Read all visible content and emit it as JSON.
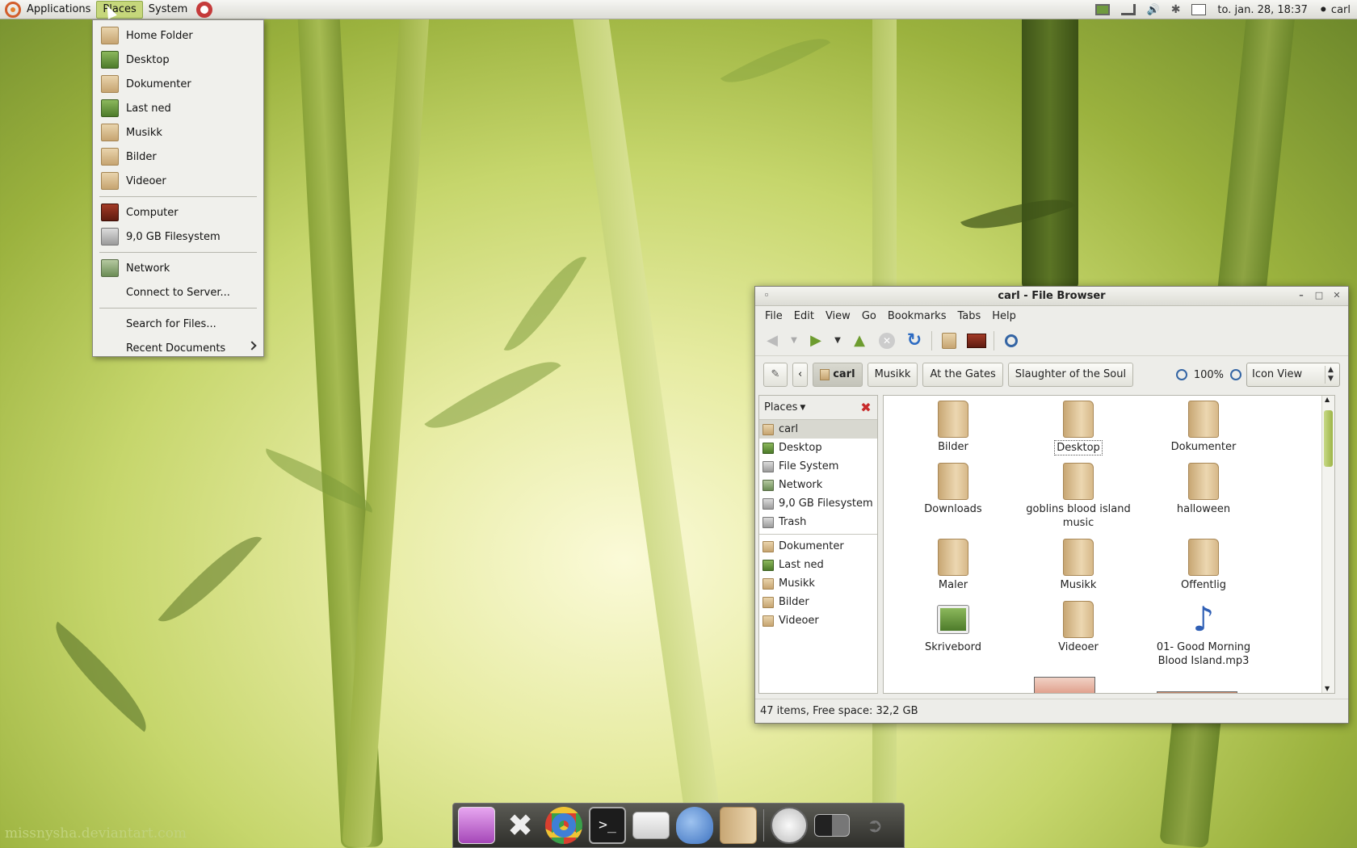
{
  "panel": {
    "applications": "Applications",
    "places": "Places",
    "system": "System",
    "clock": "to. jan. 28, 18:37",
    "user": "carl"
  },
  "places_menu": {
    "items": [
      {
        "label": "Home Folder",
        "icon": "home-folder-icon"
      },
      {
        "label": "Desktop",
        "icon": "desktop-icon"
      },
      {
        "label": "Dokumenter",
        "icon": "documents-folder-icon"
      },
      {
        "label": "Last ned",
        "icon": "downloads-icon"
      },
      {
        "label": "Musikk",
        "icon": "music-folder-icon"
      },
      {
        "label": "Bilder",
        "icon": "pictures-folder-icon"
      },
      {
        "label": "Videoer",
        "icon": "videos-folder-icon"
      },
      {
        "label": "Computer",
        "icon": "computer-icon"
      },
      {
        "label": "9,0 GB Filesystem",
        "icon": "harddisk-icon"
      },
      {
        "label": "Network",
        "icon": "network-icon"
      },
      {
        "label": "Connect to Server...",
        "icon": ""
      },
      {
        "label": "Search for Files...",
        "icon": ""
      },
      {
        "label": "Recent Documents",
        "icon": ""
      }
    ]
  },
  "window": {
    "title": "carl - File Browser",
    "menu": [
      "File",
      "Edit",
      "View",
      "Go",
      "Bookmarks",
      "Tabs",
      "Help"
    ],
    "breadcrumbs": [
      "carl",
      "Musikk",
      "At the Gates",
      "Slaughter of the Soul"
    ],
    "zoom": "100%",
    "view_mode": "Icon View",
    "sidebar_title": "Places",
    "sidebar": [
      "carl",
      "Desktop",
      "File System",
      "Network",
      "9,0 GB Filesystem",
      "Trash",
      "Dokumenter",
      "Last ned",
      "Musikk",
      "Bilder",
      "Videoer"
    ],
    "files": [
      "Bilder",
      "Desktop",
      "Dokumenter",
      "Downloads",
      "goblins blood island music",
      "halloween",
      "Maler",
      "Musikk",
      "Offentlig",
      "Skrivebord",
      "Videoer",
      "01- Good Morning Blood Island.mp3"
    ],
    "status": "47 items, Free space: 32,2 GB"
  },
  "credit": "missnysha.deviantart.com",
  "colors": {
    "accent": "#c6d77b",
    "panel": "#e8e8e2",
    "close_red": "#c82b2b"
  }
}
